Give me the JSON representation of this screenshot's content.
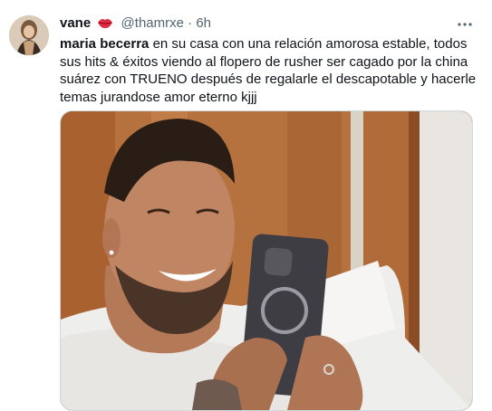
{
  "tweet": {
    "display_name": "vane",
    "handle": "@thamrxe",
    "separator": "·",
    "time": "6h",
    "emoji_icon": "lips-emoji-icon",
    "body_bold": "maria becerra",
    "body_rest": " en su casa con una relación amorosa estable, todos sus hits & éxitos viendo al flopero de rusher ser cagado por la china suárez con TRUENO después de regalarle el descapotable y hacerle temas jurandose amor eterno kjjj",
    "more_icon": "more-options-icon",
    "media_description_icon": "video-thumbnail"
  },
  "colors": {
    "text_primary": "#0f1419",
    "text_secondary": "#536471",
    "media_border": "#cfd9de"
  }
}
